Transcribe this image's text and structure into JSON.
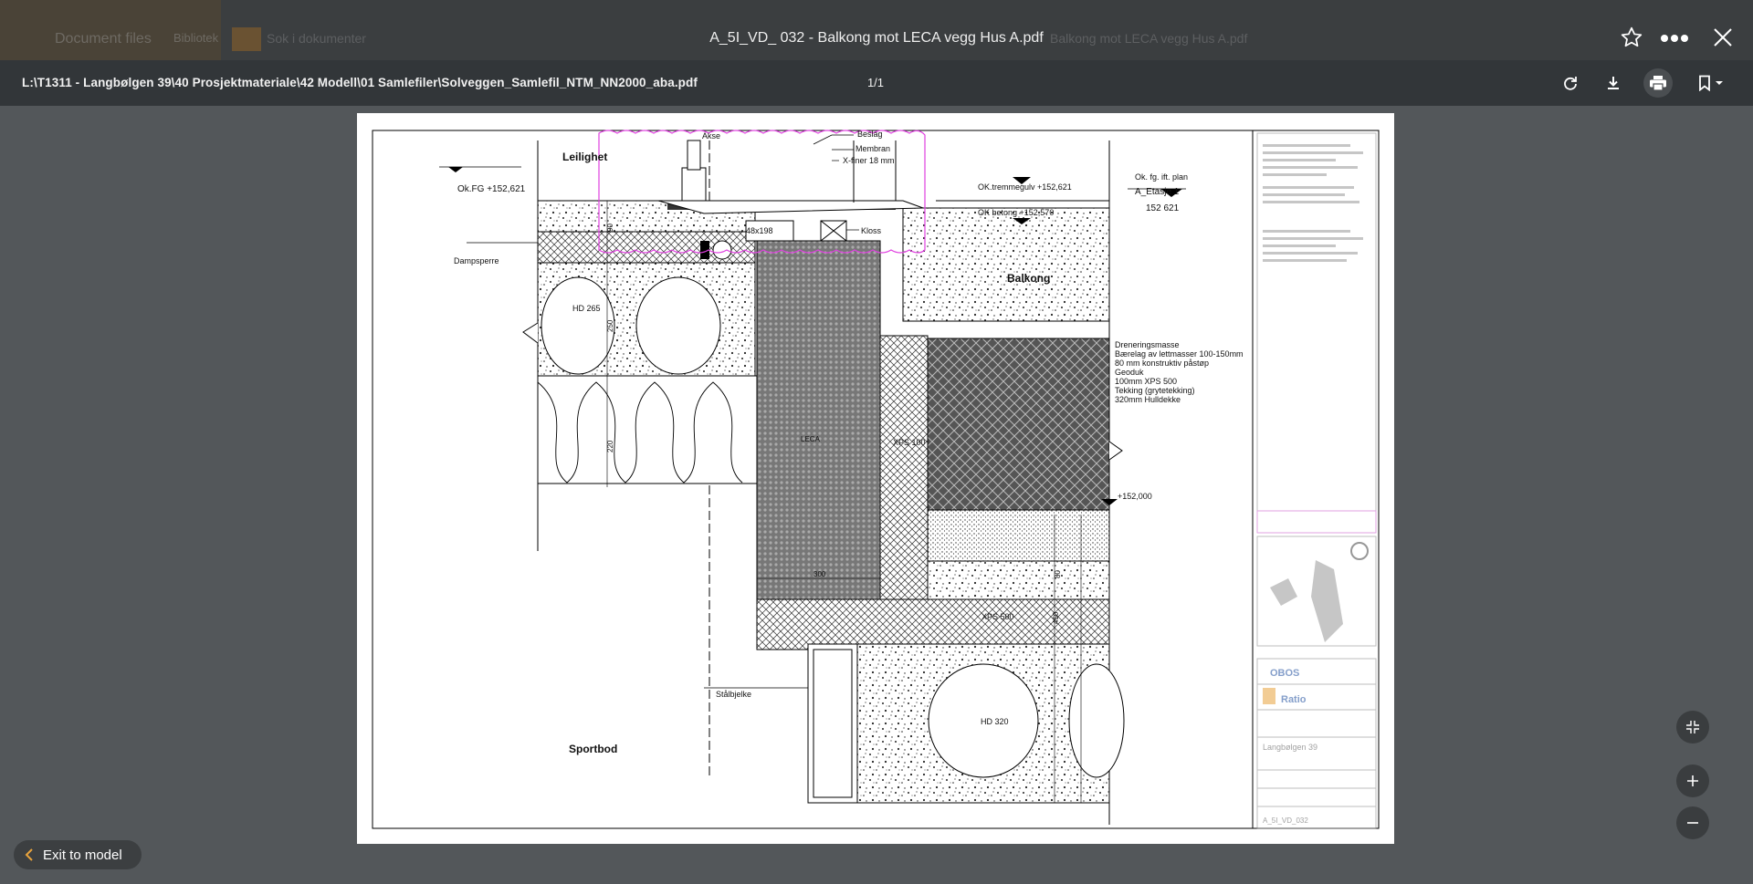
{
  "viewer": {
    "title": "A_5I_VD_ 032 - Balkong mot LECA vegg Hus A.pdf",
    "path": "L:\\T1311 - Langbølgen 39\\40 Prosjektmateriale\\42 Modell\\01 Samlefiler\\Solveggen_Samlefil_NTM_NN2000_aba.pdf",
    "page_indicator": "1/1",
    "exit_label": "Exit to model"
  },
  "background_app": {
    "tab_label": "Document files",
    "tab_suffix": "Bibliotek",
    "tab2_label": "Sok i dokumenter",
    "right_label": "Balkong mot LECA vegg Hus A.pdf"
  },
  "icons": {
    "star": "star-icon",
    "more": "more-horizontal-icon",
    "close": "close-icon",
    "rotate": "rotate-icon",
    "download": "download-icon",
    "print": "print-icon",
    "bookmark": "bookmark-icon",
    "fit": "collapse-icon",
    "zoom_in": "plus-icon",
    "zoom_out": "minus-icon",
    "back": "chevron-left-icon"
  },
  "colors": {
    "accent": "#e8a33d",
    "markup": "#e040e0"
  },
  "drawing": {
    "labels": {
      "leilighet": "Leilighet",
      "akse": "Akse",
      "beslag": "Beslag",
      "membran": "Membran",
      "xfiner": "X-finer 18 mm",
      "okfg": "Ok.FG +152,621",
      "dampsperre": "Dampsperre",
      "kloss": "Kloss",
      "planke": "48x198",
      "hd265": "HD 265",
      "balkong": "Balkong",
      "ok_tremmegulv": "OK.tremmegulv +152,621",
      "ok_betong": "OK betong +152,570",
      "okfg_plan": "Ok. fg. ift. plan",
      "etasje": "A_Etasje 1",
      "elev": "152 621",
      "xps100": "XPS 100",
      "leca": "LECA",
      "xps500": "XPS 500",
      "plus152000": "+152,000",
      "staalbjelke": "Stålbjelke",
      "hd320": "HD 320",
      "sportbod": "Sportbod",
      "dim220": "220",
      "dim250": "250",
      "dim300": "300",
      "dim80": "80",
      "dim90": "90",
      "dim450": "450"
    },
    "layers": [
      "Dreneringsmasse",
      "Bærelag av lettmasser 100-150mm",
      "80 mm konstruktiv påstøp",
      "Geoduk",
      "100mm XPS 500",
      "Tekking (grytetekking)",
      "320mm Hulldekke"
    ],
    "title_block": {
      "client": "OBOS",
      "firm": "Ratio",
      "project": "Langbølgen 39",
      "drawing_no": "A_5I_VD_032"
    }
  }
}
